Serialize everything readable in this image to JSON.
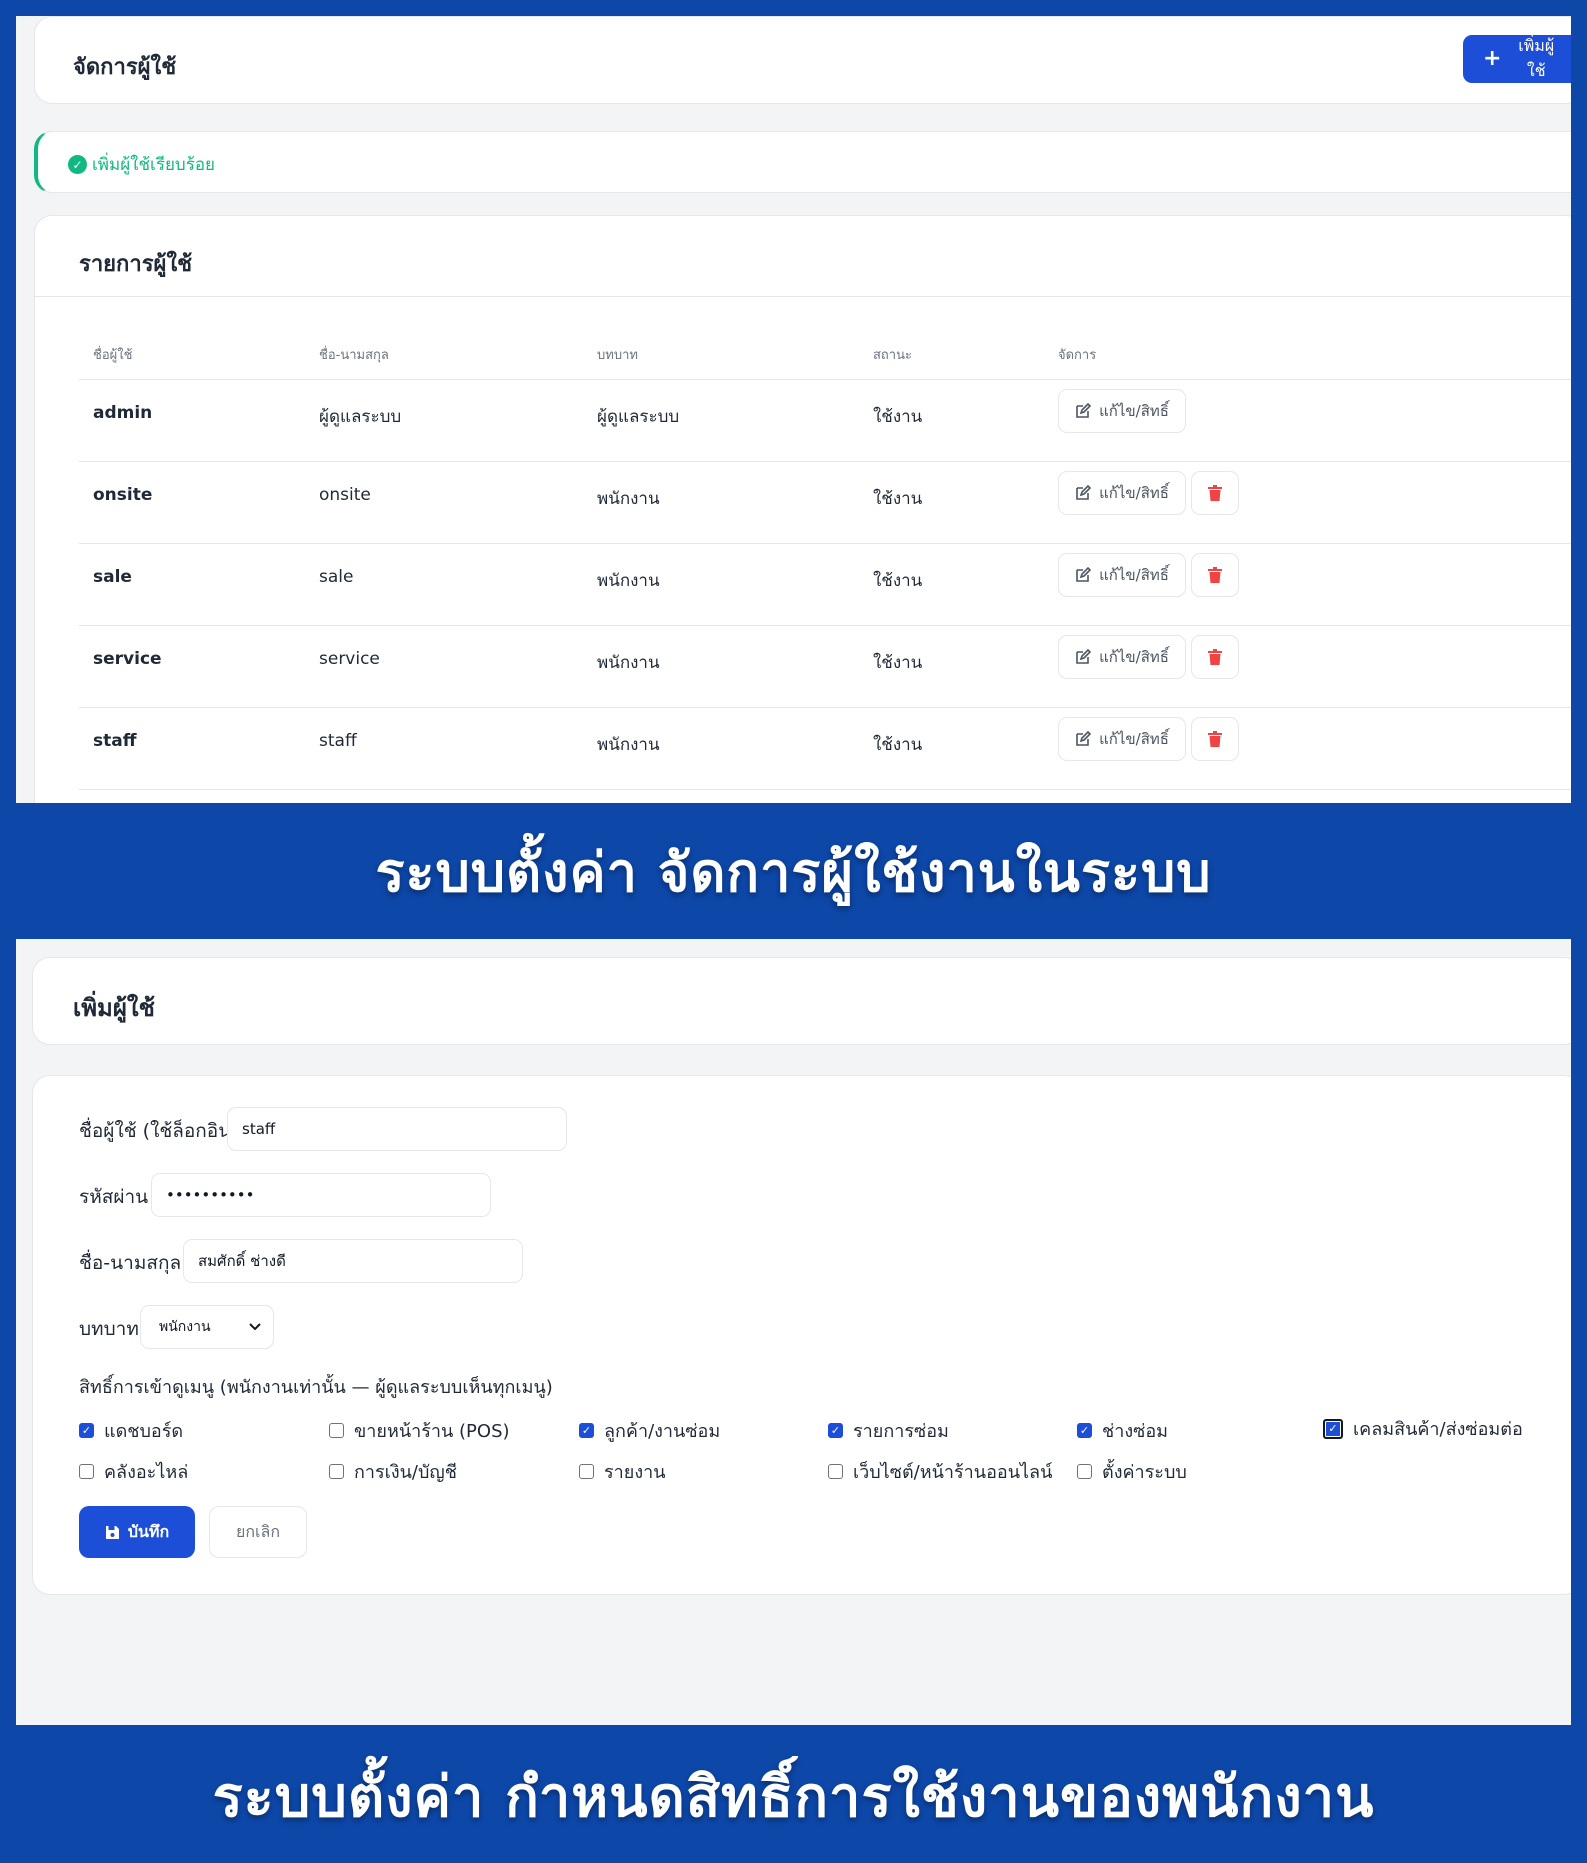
{
  "user_list_screen": {
    "header": {
      "title": "จัดการผู้ใช้",
      "add_button_label": "เพิ่มผู้ใช้"
    },
    "alert": {
      "message": "เพิ่มผู้ใช้เรียบร้อย"
    },
    "list": {
      "title": "รายการผู้ใช้",
      "columns": [
        "ชื่อผู้ใช้",
        "ชื่อ-นามสกุล",
        "บทบาท",
        "สถานะ",
        "จัดการ"
      ],
      "edit_label": "แก้ไข/สิทธิ์",
      "rows": [
        {
          "username": "admin",
          "fullname": "ผู้ดูแลระบบ",
          "role": "ผู้ดูแลระบบ",
          "status": "ใช้งาน"
        },
        {
          "username": "onsite",
          "fullname": "onsite",
          "role": "พนักงาน",
          "status": "ใช้งาน"
        },
        {
          "username": "sale",
          "fullname": "sale",
          "role": "พนักงาน",
          "status": "ใช้งาน"
        },
        {
          "username": "service",
          "fullname": "service",
          "role": "พนักงาน",
          "status": "ใช้งาน"
        },
        {
          "username": "staff",
          "fullname": "staff",
          "role": "พนักงาน",
          "status": "ใช้งาน"
        }
      ]
    }
  },
  "banner_top": "ระบบตั้งค่า จัดการผู้ใช้งานในระบบ",
  "add_user_screen": {
    "header": {
      "title": "เพิ่มผู้ใช้"
    },
    "form": {
      "username_label": "ชื่อผู้ใช้ (ใช้ล็อกอิน)",
      "username_value": "staff",
      "password_label": "รหัสผ่าน",
      "password_value": "••••••••••",
      "fullname_label": "ชื่อ-นามสกุล",
      "fullname_value": "สมศักดิ์ ช่างดี",
      "role_label": "บทบาท",
      "role_value": "พนักงาน",
      "permissions_label": "สิทธิ์การเข้าดูเมนู (พนักงานเท่านั้น — ผู้ดูแลระบบเห็นทุกเมนู)",
      "permissions": [
        {
          "label": "แดชบอร์ด",
          "checked": true
        },
        {
          "label": "ขายหน้าร้าน (POS)",
          "checked": false
        },
        {
          "label": "ลูกค้า/งานซ่อม",
          "checked": true
        },
        {
          "label": "รายการซ่อม",
          "checked": true
        },
        {
          "label": "ช่างซ่อม",
          "checked": true
        },
        {
          "label": "เคลมสินค้า/ส่งซ่อมต่อ",
          "checked": true
        },
        {
          "label": "คลังอะไหล่",
          "checked": false
        },
        {
          "label": "การเงิน/บัญชี",
          "checked": false
        },
        {
          "label": "รายงาน",
          "checked": false
        },
        {
          "label": "เว็บไซต์/หน้าร้านออนไลน์",
          "checked": false
        },
        {
          "label": "ตั้งค่าระบบ",
          "checked": false
        }
      ],
      "save_label": "บันทึก",
      "cancel_label": "ยกเลิก"
    }
  },
  "banner_bottom": "ระบบตั้งค่า กำหนดสิทธิ์การใช้งานของพนักงาน",
  "colors": {
    "primary": "#1d4ed8",
    "success": "#10b981",
    "danger": "#ef4444",
    "banner_bg": "#0d47a8"
  }
}
